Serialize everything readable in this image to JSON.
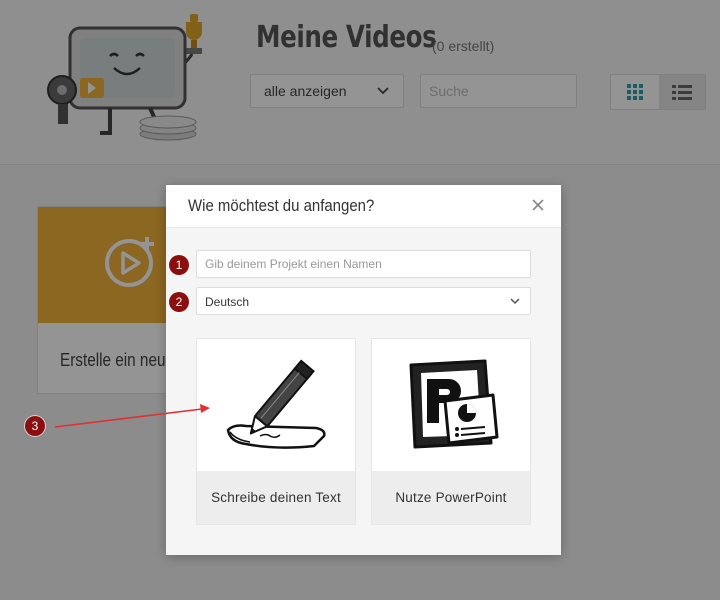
{
  "page": {
    "title": "Meine Videos",
    "count": "(0 erstellt)",
    "filter": {
      "selected": "alle anzeigen"
    },
    "search": {
      "placeholder": "Suche",
      "value": ""
    },
    "create_card": {
      "label": "Erstelle ein neue"
    }
  },
  "modal": {
    "title": "Wie möchtest du anfangen?",
    "name_input": {
      "placeholder": "Gib deinem Projekt einen Namen",
      "value": ""
    },
    "language": {
      "selected": "Deutsch"
    },
    "options": [
      {
        "label": "Schreibe deinen Text",
        "icon": "pencil-paper-icon"
      },
      {
        "label": "Nutze PowerPoint",
        "icon": "powerpoint-icon"
      }
    ]
  },
  "annotations": [
    "1",
    "2",
    "3"
  ],
  "colors": {
    "accent": "#f2b23a",
    "marker": "#8b0f0f",
    "grid_icon": "#2aa4a7",
    "arrow": "#e03030"
  }
}
